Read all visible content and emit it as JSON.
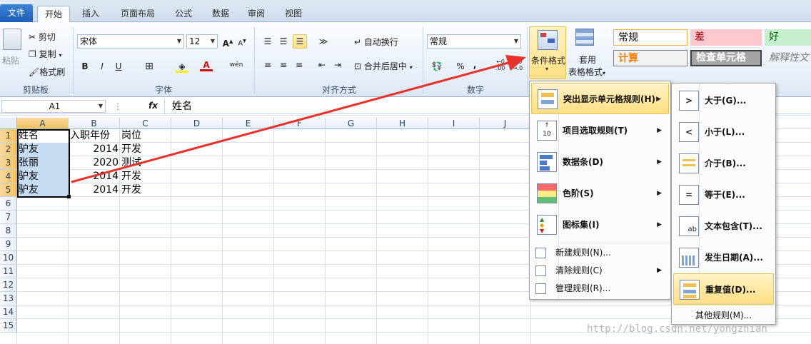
{
  "tabs": [
    "文件",
    "开始",
    "插入",
    "页面布局",
    "公式",
    "数据",
    "审阅",
    "视图"
  ],
  "clipboard": {
    "paste": "粘贴",
    "cut": "剪切",
    "copy": "复制",
    "format_painter": "格式刷",
    "group": "剪贴板"
  },
  "font": {
    "name": "宋体",
    "size": "12",
    "bold": "B",
    "italic": "I",
    "underline": "U",
    "wen": "wén",
    "group": "字体"
  },
  "alignment": {
    "wrap": "自动换行",
    "merge": "合并后居中",
    "group": "对齐方式"
  },
  "number": {
    "format": "常规",
    "percent": "%",
    "comma": ",",
    "inc": ".0\n.00",
    "group": "数字"
  },
  "styles": {
    "cond_format": "条件格式",
    "table_format_1": "套用",
    "table_format_2": "表格格式",
    "normal": "常规",
    "bad": "差",
    "good": "好",
    "calc": "计算",
    "check": "检查单元格",
    "explain": "解释性文"
  },
  "formula_bar": {
    "name_box": "A1",
    "fx": "fx",
    "value": "姓名"
  },
  "columns": [
    "A",
    "B",
    "C",
    "D",
    "E",
    "F",
    "G",
    "H",
    "I",
    "J"
  ],
  "rows": [
    "1",
    "2",
    "3",
    "4",
    "5",
    "6",
    "7",
    "8",
    "9",
    "10",
    "11",
    "12",
    "13",
    "14",
    "15"
  ],
  "cells": {
    "A1": "姓名",
    "B1": "入职年份",
    "C1": "岗位",
    "A2": "驴友",
    "B2": "2014",
    "C2": "开发",
    "A3": "张丽",
    "B3": "2020",
    "C3": "测试",
    "A4": "驴友",
    "B4": "2014",
    "C4": "开发",
    "A5": "驴友",
    "B5": "2014",
    "C5": "开发"
  },
  "cf_menu": {
    "highlight": "突出显示单元格规则(H)",
    "top_bottom": "项目选取规则(T)",
    "data_bars": "数据条(D)",
    "color_scales": "色阶(S)",
    "icon_sets": "图标集(I)",
    "new_rule": "新建规则(N)...",
    "clear_rules": "清除规则(C)",
    "manage_rules": "管理规则(R)..."
  },
  "submenu": {
    "greater": "大于(G)...",
    "less": "小于(L)...",
    "between": "介于(B)...",
    "equal": "等于(E)...",
    "text_contains": "文本包含(T)...",
    "date_occurring": "发生日期(A)...",
    "duplicate": "重复值(D)...",
    "more_rules": "其他规则(M)..."
  },
  "watermark": "http://blog.csdn.net/yongzhian",
  "colors": {
    "arrow": "#e8312a",
    "selection": "#c5dcf3",
    "highlight": "#ffe28a"
  }
}
